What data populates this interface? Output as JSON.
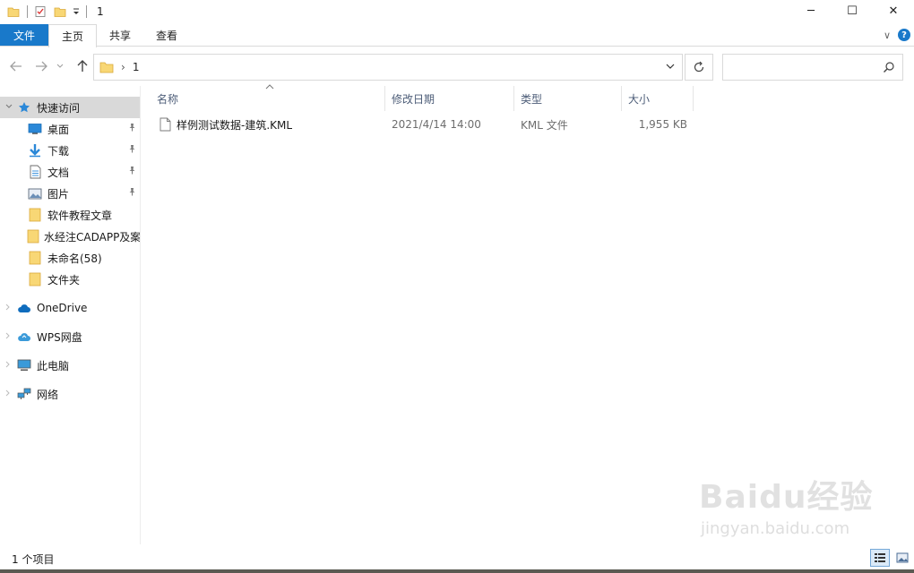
{
  "window": {
    "title": "1",
    "buttons": {
      "minimize": "─",
      "maximize": "☐",
      "close": "✕"
    }
  },
  "ribbon": {
    "tabs": [
      {
        "label": "文件"
      },
      {
        "label": "主页"
      },
      {
        "label": "共享"
      },
      {
        "label": "查看"
      }
    ],
    "expand_label": "∨",
    "help_label": "?"
  },
  "address": {
    "crumbs": [
      "1"
    ],
    "separator": "›",
    "search_placeholder": ""
  },
  "nav": {
    "quick_access": "快速访问",
    "pinned": [
      {
        "label": "桌面",
        "icon": "desktop-icon"
      },
      {
        "label": "下载",
        "icon": "download-icon"
      },
      {
        "label": "文档",
        "icon": "document-icon"
      },
      {
        "label": "图片",
        "icon": "pictures-icon"
      }
    ],
    "folders": [
      {
        "label": "软件教程文章"
      },
      {
        "label": "水经注CADAPP及案"
      },
      {
        "label": "未命名(58)"
      },
      {
        "label": "文件夹"
      }
    ],
    "roots": [
      {
        "label": "OneDrive",
        "icon": "onedrive-icon"
      },
      {
        "label": "WPS网盘",
        "icon": "wps-cloud-icon"
      },
      {
        "label": "此电脑",
        "icon": "this-pc-icon"
      },
      {
        "label": "网络",
        "icon": "network-icon"
      }
    ]
  },
  "columns": {
    "name": "名称",
    "modified": "修改日期",
    "type": "类型",
    "size": "大小"
  },
  "files": [
    {
      "name": "样例测试数据-建筑.KML",
      "modified": "2021/4/14 14:00",
      "type": "KML 文件",
      "size": "1,955 KB"
    }
  ],
  "status": {
    "count": "1 个项目"
  },
  "watermark": {
    "logo": "Baidu经验",
    "url": "jingyan.baidu.com"
  },
  "colors": {
    "accent": "#1979ca",
    "folder": "#f8d775",
    "selection": "#d9d9d9"
  }
}
